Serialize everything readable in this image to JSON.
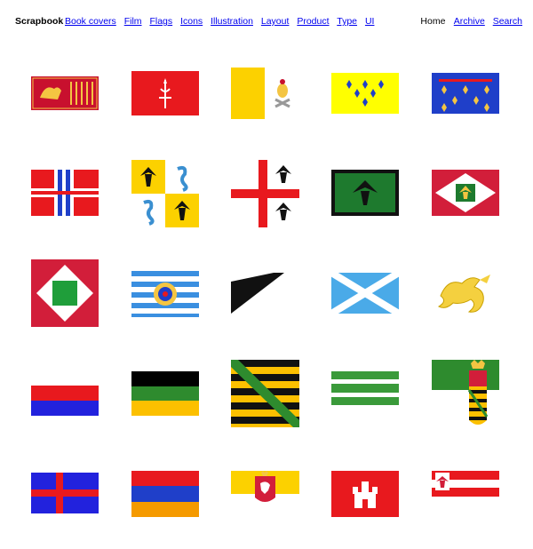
{
  "header": {
    "brand": "Scrapbook",
    "nav": [
      "Book covers",
      "Film",
      "Flags",
      "Icons",
      "Illustration",
      "Layout",
      "Product",
      "Type",
      "UI"
    ],
    "home": "Home",
    "archive": "Archive",
    "search": "Search"
  },
  "flags": [
    "venice-flag",
    "trieste-flag",
    "vatican-flag",
    "fleur-de-lis-yellow-flag",
    "fleur-de-lis-blue-flag",
    "red-blue-cross-flag",
    "eagle-serpent-quartered-flag",
    "red-cross-eagles-flag",
    "green-eagle-flag",
    "eagle-rhombus-flag",
    "green-square-rhombus-flag",
    "blue-white-stripes-arms-flag",
    "black-white-diagonal-flag",
    "scotland-saltire-flag",
    "golden-dragon-flag",
    "red-blue-flag",
    "black-green-yellow-flag",
    "saxony-crancelin-flag",
    "green-white-stripes-flag",
    "crowned-shield-flag",
    "oldenburg-cross-flag",
    "armenia-flag",
    "white-horse-flag",
    "hamburg-castle-flag",
    "eagle-red-white-flag"
  ],
  "colors": {
    "link": "#0000ee",
    "red": "#e8191e",
    "yellow": "#fcd100",
    "blue": "#1f3fc9",
    "green": "#2e8b2e"
  }
}
